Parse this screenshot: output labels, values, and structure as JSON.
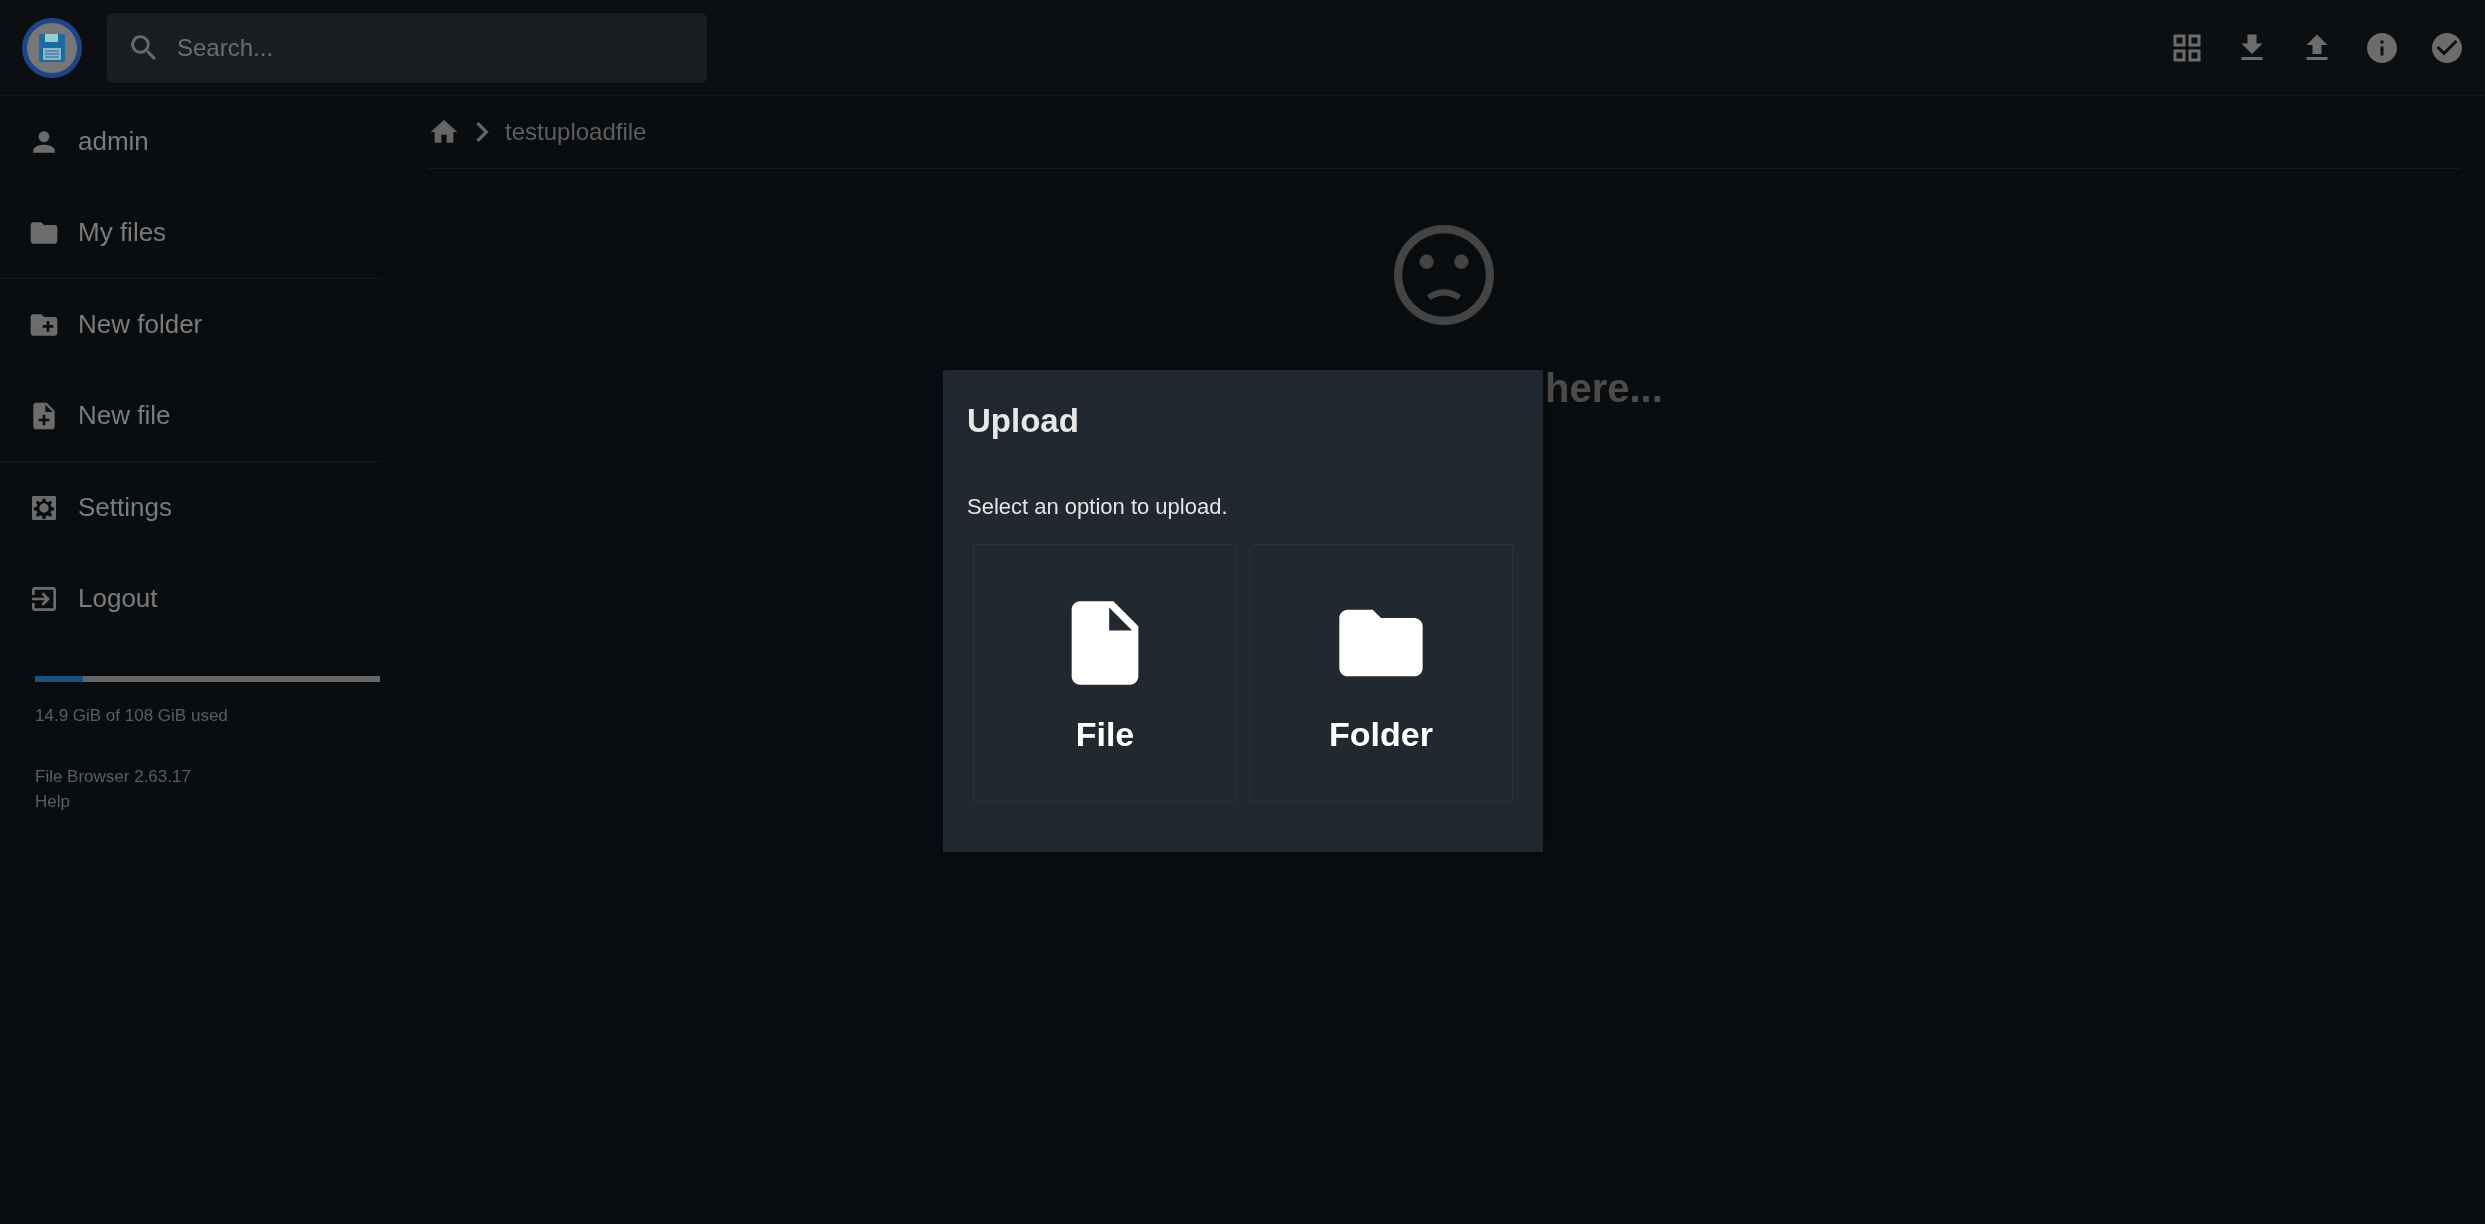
{
  "header": {
    "search": {
      "placeholder": "Search..."
    }
  },
  "sidebar": {
    "groups": [
      [
        {
          "label": "admin"
        },
        {
          "label": "My files"
        }
      ],
      [
        {
          "label": "New folder"
        },
        {
          "label": "New file"
        }
      ],
      [
        {
          "label": "Settings"
        },
        {
          "label": "Logout"
        }
      ]
    ],
    "storage": {
      "level": 0.14,
      "reading": "14.9 GiB of 108 GiB used"
    },
    "version": "File Browser 2.63.17",
    "help": "Help"
  },
  "breadcrumb": [
    "testuploadfile"
  ],
  "empty_message": "here...",
  "dialog": {
    "title": "Upload",
    "message": "Select an option to upload.",
    "options": [
      {
        "label": "File"
      },
      {
        "label": "Folder"
      }
    ]
  }
}
